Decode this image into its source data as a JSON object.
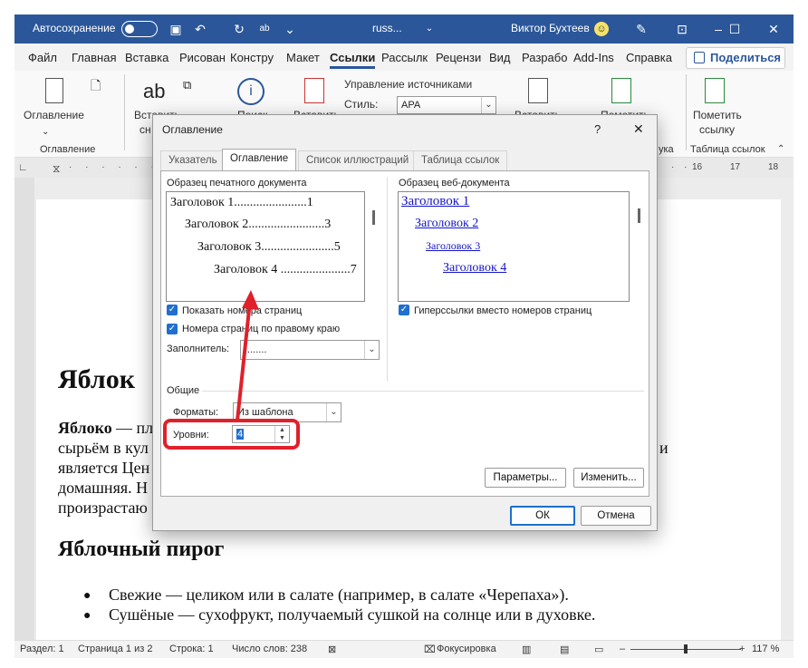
{
  "titlebar": {
    "autosave": "Автосохранение",
    "doc": "russ...",
    "user": "Виктор Бухтеев"
  },
  "menu": {
    "items": [
      "Файл",
      "Главная",
      "Вставка",
      "Рисован",
      "Констру",
      "Макет",
      "Ссылки",
      "Рассылк",
      "Рецензи",
      "Вид",
      "Разрабо",
      "Add-Ins",
      "Справка"
    ],
    "share": "Поделиться"
  },
  "ribbon": {
    "toc": "Оглавление",
    "toc_group": "Оглавление",
    "insert_footnote": "Вставить",
    "insert_footnote2": "сн",
    "search": "Поиск",
    "insert_citation": "Вставить",
    "manage_sources": "Управление источниками",
    "style_label": "Стиль:",
    "style_value": "APA",
    "insert_caption": "Вставить",
    "mark_entry": "Пометить",
    "mark_citation": "Пометить",
    "mark_citation2": "ссылку",
    "group_tail": "ука",
    "table_of_authorities": "Таблица ссылок"
  },
  "ruler": {
    "numbers": [
      "16",
      "17",
      "18"
    ]
  },
  "document": {
    "heading1": "Яблок",
    "para_line1_bold": "Яблоко",
    "para_line1": " — пл",
    "para_line2": "сырьём в кул",
    "para_line2_end": "и",
    "para_line3": "является Цен",
    "para_line4": "домашняя. Н",
    "para_line5": "произрастаю",
    "heading2": "Яблочный пирог",
    "bullet1": "Свежие — целиком или в салате (например, в салате «Черепаха»).",
    "bullet2": "Сушёные — сухофрукт, получаемый сушкой на солнце или в духовке."
  },
  "status": {
    "section": "Раздел: 1",
    "page": "Страница 1 из 2",
    "line": "Строка: 1",
    "words": "Число слов: 238",
    "focus": "Фокусировка",
    "zoom": "117 %"
  },
  "dialog": {
    "title": "Оглавление",
    "help": "?",
    "close": "✕",
    "tabs": [
      "Указатель",
      "Оглавление",
      "Список иллюстраций",
      "Таблица ссылок"
    ],
    "print_preview_label": "Образец печатного документа",
    "print_preview": [
      {
        "text": "Заголовок 1.......................1"
      },
      {
        "text": "Заголовок 2........................3"
      },
      {
        "text": "Заголовок 3.......................5"
      },
      {
        "text": "Заголовок 4 ......................7"
      }
    ],
    "web_preview_label": "Образец веб-документа",
    "web_preview": [
      "Заголовок 1",
      "Заголовок 2",
      "Заголовок 3",
      "Заголовок 4"
    ],
    "show_page_numbers": "Показать номера страниц",
    "right_align": "Номера страниц по правому краю",
    "hyperlinks": "Гиперссылки вместо номеров страниц",
    "leader_label": "Заполнитель:",
    "leader_value": "........",
    "general_label": "Общие",
    "formats_label": "Форматы:",
    "formats_value": "Из шаблона",
    "levels_label": "Уровни:",
    "levels_value": "4",
    "options_button": "Параметры...",
    "modify_button": "Изменить...",
    "ok_button": "ОК",
    "cancel_button": "Отмена"
  },
  "colors": {
    "accent": "#2b579a",
    "annotation": "#e0202a",
    "link": "#1515c8"
  }
}
